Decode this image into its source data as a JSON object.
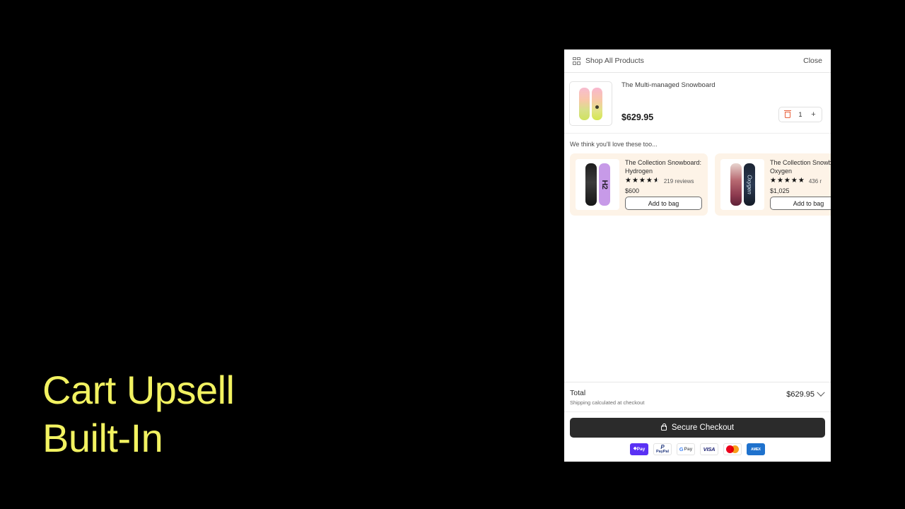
{
  "headline": "Cart Upsell\nBuilt-In",
  "accent_color": "#f2f261",
  "drawer": {
    "header": {
      "shop_all_label": "Shop All Products",
      "close_label": "Close"
    },
    "cart_item": {
      "title": "The Multi-managed Snowboard",
      "price": "$629.95",
      "quantity": "1",
      "increase_label": "+"
    },
    "recommendations": {
      "heading": "We think you'll love these too...",
      "cards": [
        {
          "name": "The Collection Snowboard: Hydrogen",
          "rating": 4.5,
          "reviews": "219 reviews",
          "price": "$600",
          "cta": "Add to bag",
          "board_label": "H2"
        },
        {
          "name": "The Collection Snowboard: Oxygen",
          "rating": 5,
          "reviews": "436 r",
          "price": "$1,025",
          "cta": "Add to bag",
          "board_label": "Oxygen"
        }
      ]
    },
    "footer": {
      "total_label": "Total",
      "shipping_note": "Shipping calculated at checkout",
      "total_amount": "$629.95",
      "checkout_label": "Secure Checkout",
      "payment_methods": [
        {
          "name": "shop-pay",
          "text": "Pay"
        },
        {
          "name": "paypal",
          "text": "PayPal"
        },
        {
          "name": "google-pay",
          "text": "Pay"
        },
        {
          "name": "visa",
          "text": "VISA"
        },
        {
          "name": "mastercard",
          "text": ""
        },
        {
          "name": "amex",
          "text": "AMEX"
        }
      ]
    },
    "card_bg": "#fdf3e7",
    "checkout_bg": "#2b2b2b"
  }
}
